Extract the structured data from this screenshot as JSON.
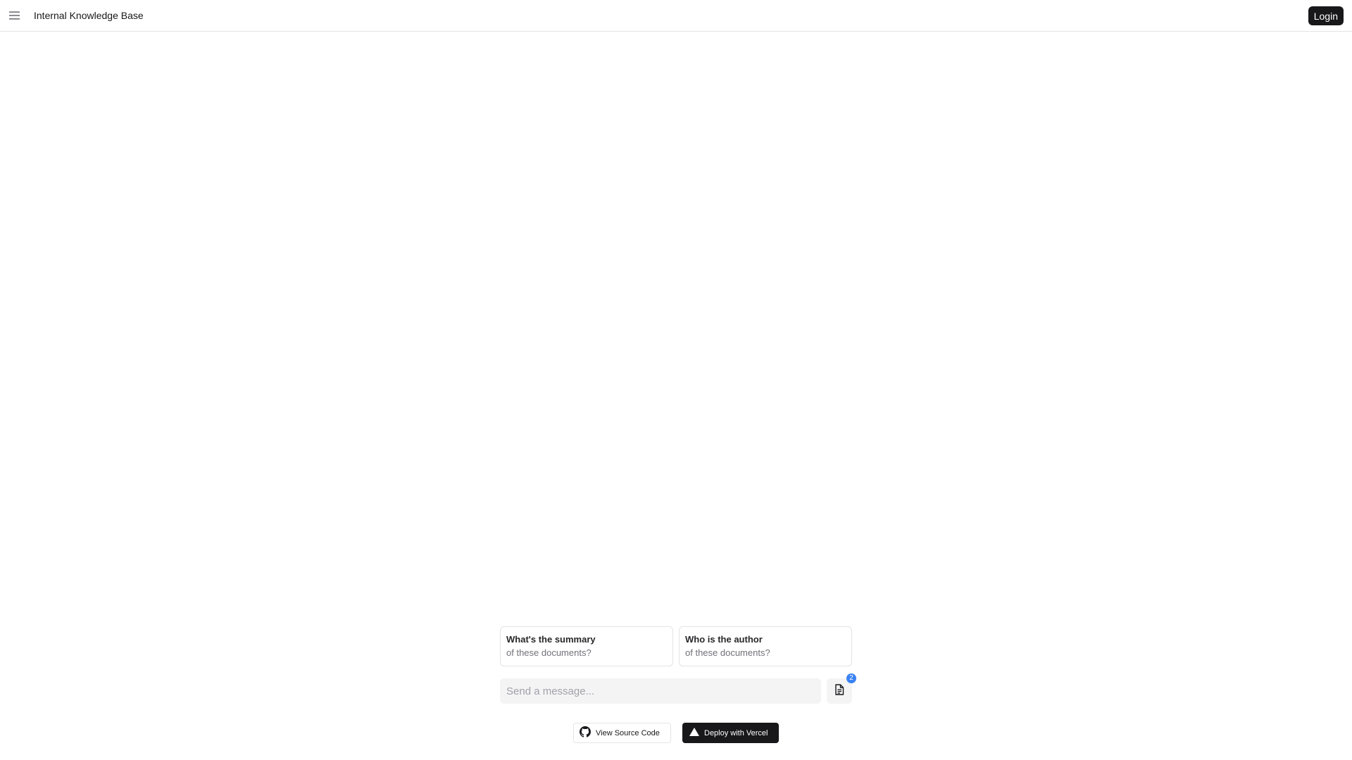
{
  "header": {
    "menu_icon": "menu-icon",
    "title": "Internal Knowledge Base",
    "login_label": "Login"
  },
  "suggestions": [
    {
      "line1": "What's the summary",
      "line2": "of these documents?"
    },
    {
      "line1": "Who is the author",
      "line2": "of these documents?"
    }
  ],
  "composer": {
    "placeholder": "Send a message...",
    "files_icon": "file-icon",
    "files_count": "2"
  },
  "footer": {
    "source_label": "View Source Code",
    "source_icon": "github-icon",
    "deploy_label": "Deploy with Vercel",
    "deploy_icon": "vercel-triangle-icon"
  },
  "colors": {
    "primary": "#18181b",
    "badge": "#3b82f6",
    "input_bg": "#f4f4f5",
    "border": "#e4e4e7"
  }
}
